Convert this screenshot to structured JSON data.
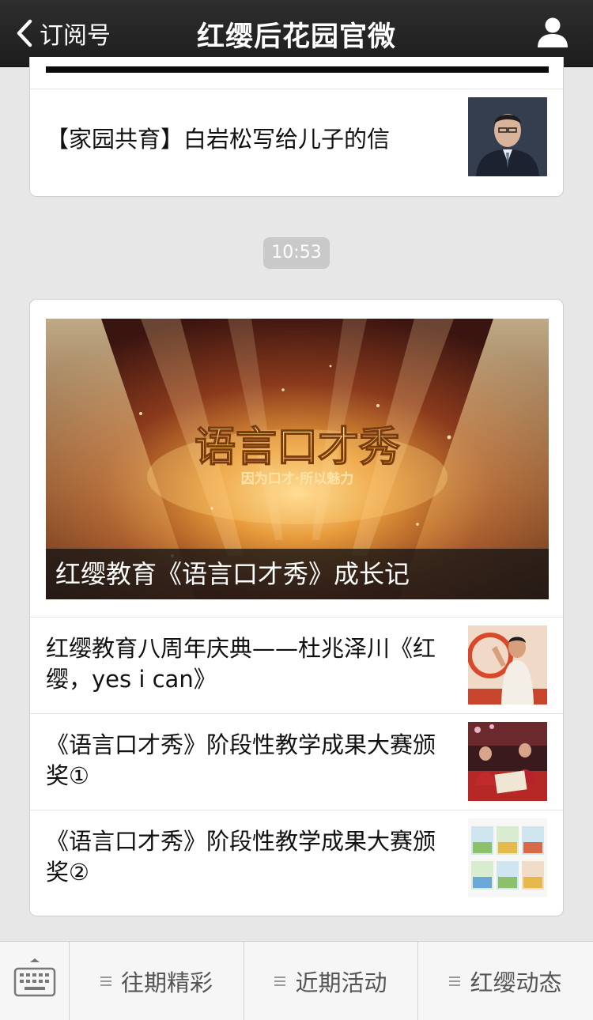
{
  "header": {
    "back_label": "订阅号",
    "title": "红缨后花园官微",
    "back_icon": "chevron-left-icon",
    "profile_icon": "person-icon"
  },
  "messages": {
    "previous_card": {
      "items": [
        {
          "title": "【家园共育】白岩松写给儿子的信"
        }
      ]
    },
    "timestamp": "10:53",
    "current_card": {
      "cover": {
        "art_title": "语言口才秀",
        "art_subtitle": "因为口才·所以魅力",
        "caption": "红缨教育《语言口才秀》成长记"
      },
      "items": [
        {
          "title": "红缨教育八周年庆典——杜兆泽川《红缨，yes i can》"
        },
        {
          "title": "《语言口才秀》阶段性教学成果大赛颁奖①"
        },
        {
          "title": "《语言口才秀》阶段性教学成果大赛颁奖②"
        }
      ]
    }
  },
  "bottom_menu": {
    "keyboard_icon": "keyboard-icon",
    "items": [
      {
        "label": "往期精彩"
      },
      {
        "label": "近期活动"
      },
      {
        "label": "红缨动态"
      }
    ]
  },
  "colors": {
    "navbar": "#262626",
    "background": "#e7e7e7",
    "card": "#ffffff",
    "cover_gold": "#f4c24a"
  }
}
